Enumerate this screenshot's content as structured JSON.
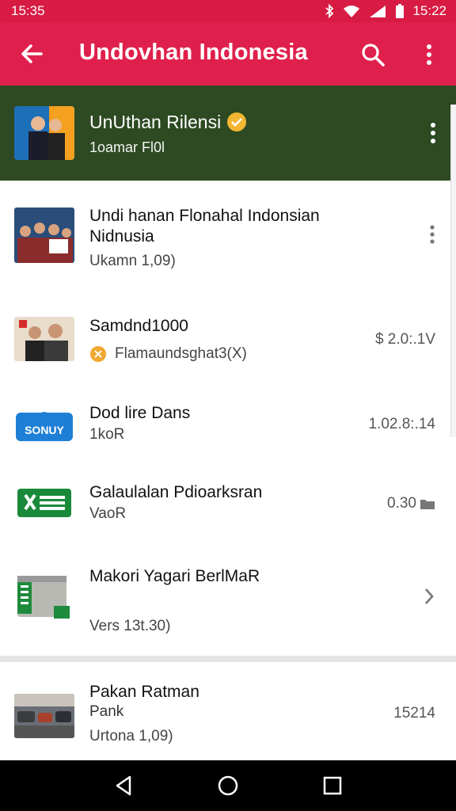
{
  "status_bar": {
    "time_left": "15:35",
    "time_right": "15:22"
  },
  "app_bar": {
    "title": "Undovhan Indonesia",
    "colors": {
      "primary": "#e0204c",
      "status": "#d81b43"
    }
  },
  "featured": {
    "title": "UnUthan Rilensi",
    "subtitle": "1oamar Fl0l",
    "background": "#2d4a22",
    "badge_color": "#f2b632"
  },
  "items": [
    {
      "title": "Undi hanan Flonahal Indonsian Nidnusia",
      "subtitle": "Ukamn 1,09)",
      "right": "",
      "right_icon": "kebab-icon"
    },
    {
      "title": "Samdnd1000",
      "subtitle": "Flamaundsghat3(X)",
      "right": "$ 2.0:.1V",
      "right_icon": ""
    },
    {
      "title": "Dod lire Dans",
      "subtitle": "1koR",
      "right": "1.02.8:.14",
      "right_icon": ""
    },
    {
      "title": "Galaulalan Pdioarksran",
      "subtitle": "VaoR",
      "right": "0.30",
      "right_icon": "folder-icon"
    },
    {
      "title": "Makori Yagari BerlMaR",
      "subtitle": "Vers 13t.30)",
      "right": "",
      "right_icon": "chevron-right-icon"
    },
    {
      "title": "Pakan Ratman",
      "subtitle2": "Pank",
      "subtitle": "Urtona 1,09)",
      "right": "15214",
      "right_icon": ""
    }
  ],
  "thumb_labels": {
    "weather": "SONUY"
  }
}
